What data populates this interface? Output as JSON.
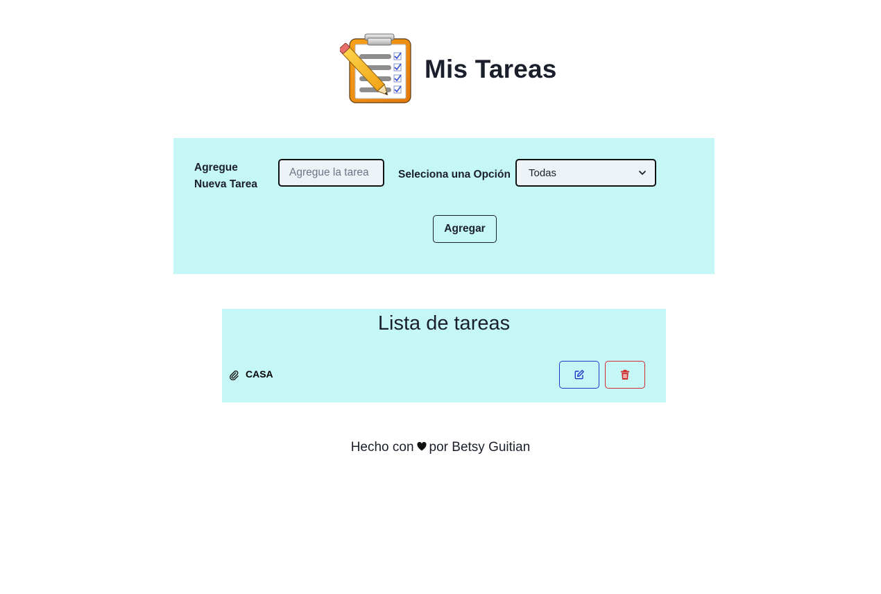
{
  "header": {
    "title": "Mis Tareas",
    "logo_icon": "clipboard-checklist-pencil-icon"
  },
  "form": {
    "new_task_label": "Agregue Nueva Tarea",
    "task_input": {
      "value": "",
      "placeholder": "Agregue la tarea"
    },
    "option_label": "Seleciona una Opción",
    "filter_select": {
      "selected": "Todas",
      "icon": "chevron-down-icon"
    },
    "add_button_label": "Agregar"
  },
  "task_list": {
    "title": "Lista de tareas",
    "items": [
      {
        "text": "CASA",
        "icon": "paperclip-icon",
        "edit_icon": "edit-icon",
        "delete_icon": "trash-icon"
      }
    ]
  },
  "footer": {
    "prefix": "Hecho con",
    "icon": "heart-icon",
    "suffix": "por Betsy Guitian"
  },
  "colors": {
    "panel_background": "#c5f7f7",
    "input_background": "#edf2f7",
    "text": "#1a1f2b",
    "edit_accent": "#1d37c9",
    "delete_accent": "#d02a2a"
  }
}
